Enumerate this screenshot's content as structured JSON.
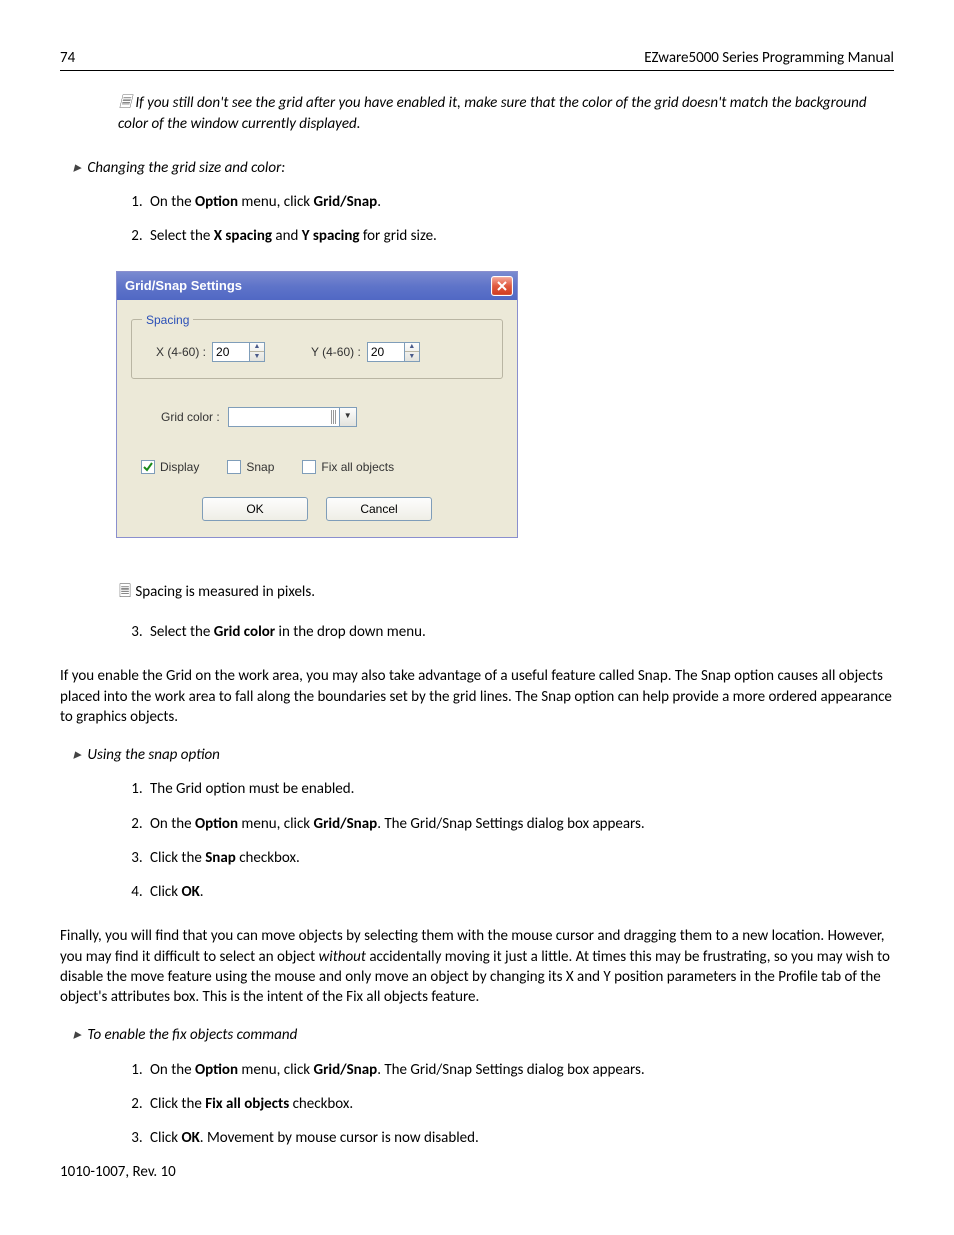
{
  "header": {
    "page_number": "74",
    "title": "EZware5000 Series Programming Manual"
  },
  "note_top": "If you still don't see the grid after you have enabled it, make sure that the color of the grid doesn't match the background color of the window currently displayed.",
  "task1": {
    "heading": "Changing the grid size and color:",
    "step1_a": "On the ",
    "step1_b": "Option",
    "step1_c": " menu, click ",
    "step1_d": "Grid/Snap",
    "step1_e": ".",
    "step2_a": "Select the ",
    "step2_b": "X spacing",
    "step2_c": " and ",
    "step2_d": "Y spacing",
    "step2_e": " for grid size."
  },
  "dialog": {
    "title": "Grid/Snap Settings",
    "spacing_legend": "Spacing",
    "x_label": "X (4-60) :",
    "x_value": "20",
    "y_label": "Y (4-60) :",
    "y_value": "20",
    "gridcolor_label": "Grid  color :",
    "chk_display": "Display",
    "chk_snap": "Snap",
    "chk_fixall": "Fix all objects",
    "ok": "OK",
    "cancel": "Cancel"
  },
  "subnote": "Spacing is measured in pixels.",
  "task1b": {
    "step3_a": "Select the ",
    "step3_b": "Grid color",
    "step3_c": " in the drop down menu."
  },
  "para_snap": "If you enable the Grid on the work area, you may also take advantage of a useful feature called Snap. The Snap option causes all objects placed into the work area to fall along the boundaries set by the grid lines. The Snap option can help provide a more ordered appearance to graphics objects.",
  "task2": {
    "heading": "Using the snap option",
    "s1": "The Grid option must be enabled.",
    "s2_a": "On the ",
    "s2_b": "Option",
    "s2_c": " menu, click ",
    "s2_d": "Grid/Snap",
    "s2_e": ". The Grid/Snap Settings dialog box appears.",
    "s3_a": "Click the ",
    "s3_b": "Snap",
    "s3_c": " checkbox.",
    "s4_a": "Click ",
    "s4_b": "OK",
    "s4_c": "."
  },
  "para_fix_a": "Finally, you will find that you can move objects by selecting them with the mouse cursor and dragging them to a new location. However, you may find it difficult to select an object ",
  "para_fix_b": "without",
  "para_fix_c": " accidentally moving it just a little. At times this may be frustrating, so you may wish to disable the move feature using the mouse and only move an object by changing its X and Y position parameters in the Profile tab of the object's attributes box. This is the intent of the Fix all objects feature.",
  "task3": {
    "heading": "To enable the fix objects command",
    "s1_a": "On the ",
    "s1_b": "Option",
    "s1_c": " menu, click ",
    "s1_d": "Grid/Snap",
    "s1_e": ". The Grid/Snap Settings dialog box appears.",
    "s2_a": "Click the ",
    "s2_b": "Fix all objects",
    "s2_c": " checkbox.",
    "s3_a": "Click ",
    "s3_b": "OK",
    "s3_c": ". Movement by mouse cursor is now disabled."
  },
  "footer": "1010-1007, Rev. 10"
}
